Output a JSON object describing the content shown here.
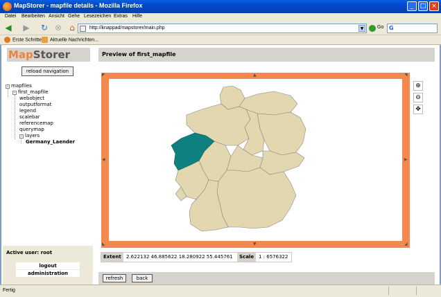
{
  "window": {
    "title": "MapStorer - mapfile details - Mozilla Firefox",
    "controls": {
      "minimize": "_",
      "maximize": "□",
      "close": "×"
    }
  },
  "menu": [
    "Datei",
    "Bearbeiten",
    "Ansicht",
    "Gehe",
    "Lesezeichen",
    "Extras",
    "Hilfe"
  ],
  "navigation": {
    "url": "http://knappad/mapstorer/main.php",
    "go_label": "Go",
    "search_engine": "G"
  },
  "bookmarks": [
    "Erste Schritte",
    "Aktuelle Nachrichten..."
  ],
  "sidebar": {
    "logo_map": "Map",
    "logo_storer": "Storer",
    "reload_label": "reload navigation",
    "tree": {
      "root": "mapfiles",
      "mapfile": "first_mapfile",
      "children": [
        "webobject",
        "outputformat",
        "legend",
        "scalebar",
        "referencemap",
        "querymap"
      ],
      "layers": "layers",
      "layer_items": [
        "Germany_Laender"
      ]
    },
    "active_user": "Active user: root",
    "links": [
      "logout",
      "administration"
    ]
  },
  "main": {
    "header": "Preview of first_mapfile",
    "extent_label": "Extent",
    "extent_value": "2.622132 46.885622 18.280922 55.445761",
    "scale_label": "Scale",
    "scale_value": "1 : 6576322",
    "buttons": [
      "refresh",
      "back"
    ],
    "map": {
      "highlight_color": "#0e8080",
      "land_color": "#e2d7ae",
      "frame_color": "#f3894f"
    }
  },
  "status": {
    "text": "Fertig"
  }
}
